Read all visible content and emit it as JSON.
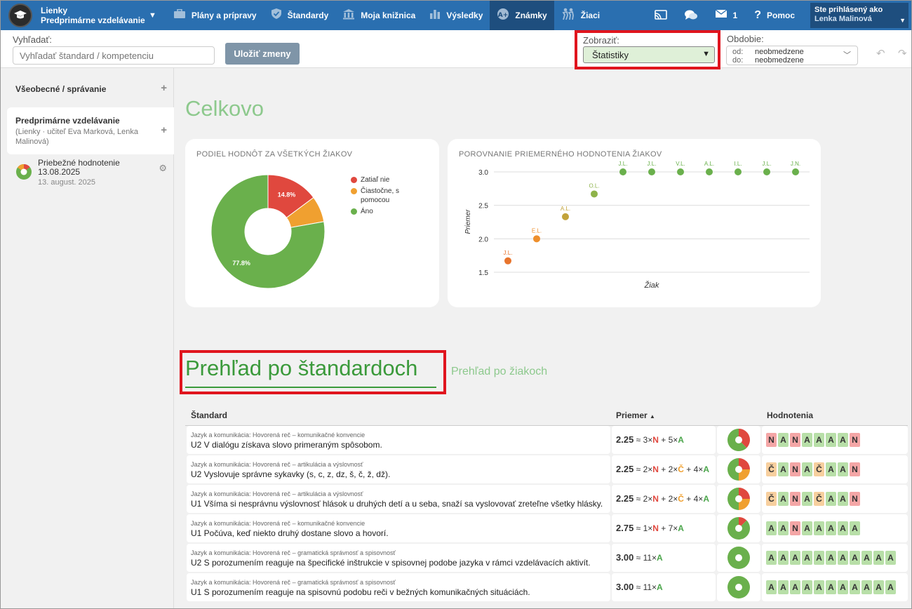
{
  "app": {
    "brand_line1": "Lienky",
    "brand_line2": "Predprimárne vzdelávanie"
  },
  "nav": {
    "items": [
      {
        "label": "Plány a prípravy",
        "icon": "briefcase-icon"
      },
      {
        "label": "Štandardy",
        "icon": "shield-check-icon"
      },
      {
        "label": "Moja knižnica",
        "icon": "library-icon"
      },
      {
        "label": "Výsledky",
        "icon": "bar-chart-icon"
      },
      {
        "label": "Známky",
        "icon": "grade-icon",
        "active": true
      },
      {
        "label": "Žiaci",
        "icon": "students-icon"
      }
    ],
    "messages_count": "1",
    "help_label": "Pomoc",
    "user_label": "Ste prihlásený ako",
    "user_name": "Lenka Malinová"
  },
  "toolbar": {
    "search_label": "Vyhľadať:",
    "search_placeholder": "Vyhľadať štandard / kompetenciu",
    "save_label": "Uložiť zmeny",
    "view_label": "Zobraziť:",
    "view_value": "Štatistiky",
    "period_label": "Obdobie:",
    "period_from_key": "od:",
    "period_from": "neobmedzene",
    "period_to_key": "do:",
    "period_to": "neobmedzene"
  },
  "sidebar": {
    "item1": "Všeobecné / správanie",
    "item2_title": "Predprimárne vzdelávanie",
    "item2_sub": "(Lienky · učiteľ Eva Marková, Lenka Malinová)",
    "item3_title": "Priebežné hodnotenie 13.08.2025",
    "item3_date": "13. august. 2025"
  },
  "main": {
    "heading": "Celkovo",
    "pie_title": "PODIEL HODNÔT ZA VŠETKÝCH ŽIAKOV",
    "scatter_title": "POROVNANIE PRIEMERNÉHO HODNOTENIA ŽIAKOV",
    "standards_heading": "Prehľad po štandardoch",
    "students_link": "Prehľad po žiakoch"
  },
  "colors": {
    "nie": "#e0483e",
    "ciastocne": "#f0a030",
    "ano": "#6ab04c",
    "accent": "#2a6fb0"
  },
  "chart_data": [
    {
      "type": "pie",
      "title": "PODIEL HODNÔT ZA VŠETKÝCH ŽIAKOV",
      "categories": [
        "Zatiaľ nie",
        "Čiastočne, s pomocou",
        "Áno"
      ],
      "values": [
        14.8,
        7.4,
        77.8
      ],
      "data_labels": [
        "14.8%",
        "",
        "77.8%"
      ],
      "legend": "right"
    },
    {
      "type": "scatter",
      "title": "POROVNANIE PRIEMERNÉHO HODNOTENIA ŽIAKOV",
      "xlabel": "Žiak",
      "ylabel": "Priemer",
      "ylim": [
        1.5,
        3.0
      ],
      "yticks": [
        "3.0",
        "2.5",
        "2.0",
        "1.5"
      ],
      "grid": true,
      "x": [
        "J.L.",
        "E.L.",
        "A.L.",
        "O.L.",
        "J.L.",
        "J.L.",
        "V.L.",
        "A.L.",
        "I.L.",
        "J.L.",
        "J.N."
      ],
      "y": [
        1.67,
        2.0,
        2.33,
        2.67,
        3.0,
        3.0,
        3.0,
        3.0,
        3.0,
        3.0,
        3.0
      ],
      "colors": [
        "#e8742c",
        "#ee8f2c",
        "#c2a33a",
        "#8eb34a",
        "#6ab04c",
        "#6ab04c",
        "#6ab04c",
        "#6ab04c",
        "#6ab04c",
        "#6ab04c",
        "#6ab04c"
      ]
    }
  ],
  "table": {
    "headers": {
      "standard": "Štandard",
      "avg": "Priemer",
      "grades": "Hodnotenia"
    },
    "rows": [
      {
        "cat": "Jazyk a komunikácia: Hovorená reč – komunikačné konvencie",
        "title": "U2 V dialógu získava slovo primeraným spôsobom.",
        "avg": "2.25",
        "formula": [
          {
            "t": " ≈ 3×"
          },
          {
            "t": "N",
            "c": "cN"
          },
          {
            "t": " + 5×"
          },
          {
            "t": "A",
            "c": "cA"
          }
        ],
        "pie": [
          3,
          0,
          5
        ],
        "grades": [
          "N",
          "A",
          "N",
          "A",
          "A",
          "A",
          "A",
          "N"
        ]
      },
      {
        "cat": "Jazyk a komunikácia: Hovorená reč – artikulácia a výslovnosť",
        "title": "U2 Vyslovuje správne sykavky (s, c, z, dz, š, č, ž, dž).",
        "avg": "2.25",
        "formula": [
          {
            "t": " ≈ 2×"
          },
          {
            "t": "N",
            "c": "cN"
          },
          {
            "t": " + 2×"
          },
          {
            "t": "Č",
            "c": "cC"
          },
          {
            "t": " + 4×"
          },
          {
            "t": "A",
            "c": "cA"
          }
        ],
        "pie": [
          2,
          2,
          4
        ],
        "grades": [
          "Č",
          "A",
          "N",
          "A",
          "Č",
          "A",
          "A",
          "N"
        ]
      },
      {
        "cat": "Jazyk a komunikácia: Hovorená reč – artikulácia a výslovnosť",
        "title": "U1 Všíma si nesprávnu výslovnosť hlások u druhých detí a u seba, snaží sa vyslovovať zreteľne všetky hlásky.",
        "avg": "2.25",
        "formula": [
          {
            "t": " ≈ 2×"
          },
          {
            "t": "N",
            "c": "cN"
          },
          {
            "t": " + 2×"
          },
          {
            "t": "Č",
            "c": "cC"
          },
          {
            "t": " + 4×"
          },
          {
            "t": "A",
            "c": "cA"
          }
        ],
        "pie": [
          2,
          2,
          4
        ],
        "grades": [
          "Č",
          "A",
          "N",
          "A",
          "Č",
          "A",
          "A",
          "N"
        ]
      },
      {
        "cat": "Jazyk a komunikácia: Hovorená reč – komunikačné konvencie",
        "title": "U1 Počúva, keď niekto druhý dostane slovo a hovorí.",
        "avg": "2.75",
        "formula": [
          {
            "t": " ≈ 1×"
          },
          {
            "t": "N",
            "c": "cN"
          },
          {
            "t": " + 7×"
          },
          {
            "t": "A",
            "c": "cA"
          }
        ],
        "pie": [
          1,
          0,
          7
        ],
        "grades": [
          "A",
          "A",
          "N",
          "A",
          "A",
          "A",
          "A",
          "A"
        ]
      },
      {
        "cat": "Jazyk a komunikácia: Hovorená reč – gramatická správnosť a spisovnosť",
        "title": "U2 S porozumením reaguje na špecifické inštrukcie v spisovnej podobe jazyka v rámci vzdelávacích aktivít.",
        "avg": "3.00",
        "formula": [
          {
            "t": " ≈ 11×"
          },
          {
            "t": "A",
            "c": "cA"
          }
        ],
        "pie": [
          0,
          0,
          11
        ],
        "grades": [
          "A",
          "A",
          "A",
          "A",
          "A",
          "A",
          "A",
          "A",
          "A",
          "A",
          "A"
        ]
      },
      {
        "cat": "Jazyk a komunikácia: Hovorená reč – gramatická správnosť a spisovnosť",
        "title": "U1 S porozumením reaguje na spisovnú podobu reči v bežných komunikačných situáciách.",
        "avg": "3.00",
        "formula": [
          {
            "t": " ≈ 11×"
          },
          {
            "t": "A",
            "c": "cA"
          }
        ],
        "pie": [
          0,
          0,
          11
        ],
        "grades": [
          "A",
          "A",
          "A",
          "A",
          "A",
          "A",
          "A",
          "A",
          "A",
          "A",
          "A"
        ]
      }
    ]
  }
}
